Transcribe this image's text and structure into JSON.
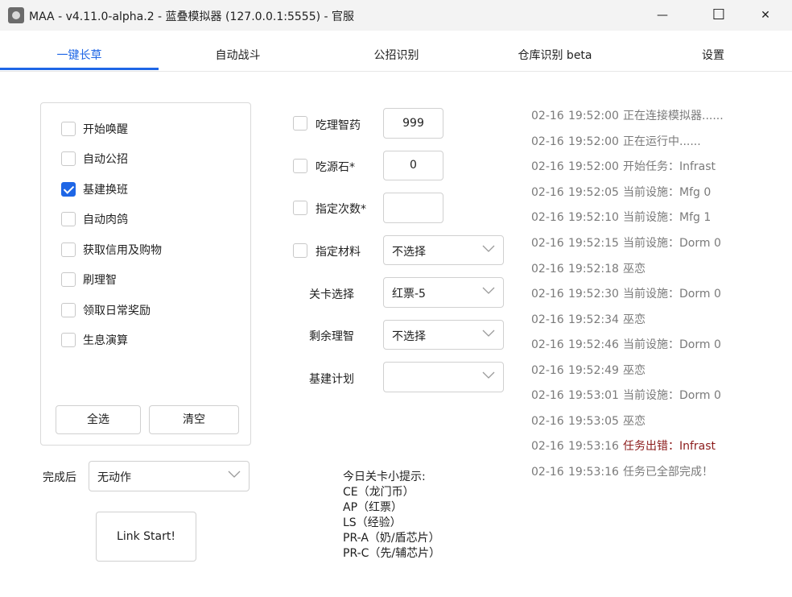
{
  "window": {
    "title": "MAA - v4.11.0-alpha.2 - 蓝叠模拟器 (127.0.0.1:5555) - 官服",
    "controls": {
      "minimize": "—",
      "maximize": "☐",
      "close": "✕"
    }
  },
  "tabs": [
    {
      "label": "一键长草"
    },
    {
      "label": "自动战斗"
    },
    {
      "label": "公招识别"
    },
    {
      "label": "仓库识别 beta"
    },
    {
      "label": "设置"
    }
  ],
  "tasks": {
    "items": [
      {
        "label": "开始唤醒",
        "checked": false
      },
      {
        "label": "自动公招",
        "checked": false
      },
      {
        "label": "基建换班",
        "checked": true
      },
      {
        "label": "自动肉鸽",
        "checked": false
      },
      {
        "label": "获取信用及购物",
        "checked": false
      },
      {
        "label": "刷理智",
        "checked": false
      },
      {
        "label": "领取日常奖励",
        "checked": false
      },
      {
        "label": "生息演算",
        "checked": false
      }
    ],
    "select_all_label": "全选",
    "clear_label": "清空"
  },
  "after_complete": {
    "label": "完成后",
    "value": "无动作"
  },
  "link_start_label": "Link Start!",
  "options": {
    "use_potion": {
      "label": "吃理智药",
      "value": "999",
      "checked": false
    },
    "use_stone": {
      "label": "吃源石*",
      "value": "0",
      "checked": false
    },
    "times": {
      "label": "指定次数*",
      "value": "",
      "checked": false
    },
    "material": {
      "label": "指定材料",
      "value": "不选择",
      "checked": false
    },
    "stage": {
      "label": "关卡选择",
      "value": "红票-5"
    },
    "remaining": {
      "label": "剩余理智",
      "value": "不选择"
    },
    "infrast_plan": {
      "label": "基建计划",
      "value": ""
    }
  },
  "hints": {
    "title": "今日关卡小提示:",
    "lines": [
      "CE（龙门币）",
      "AP（红票）",
      "LS（经验）",
      "PR-A（奶/盾芯片）",
      "PR-C（先/辅芯片）"
    ]
  },
  "logs": [
    {
      "date": "02-16",
      "time": "19:52:00",
      "msg": "正在连接模拟器......",
      "error": false
    },
    {
      "date": "02-16",
      "time": "19:52:00",
      "msg": "正在运行中......",
      "error": false
    },
    {
      "date": "02-16",
      "time": "19:52:00",
      "msg": "开始任务：Infrast",
      "error": false
    },
    {
      "date": "02-16",
      "time": "19:52:05",
      "msg": "当前设施：Mfg 0",
      "error": false
    },
    {
      "date": "02-16",
      "time": "19:52:10",
      "msg": "当前设施：Mfg 1",
      "error": false
    },
    {
      "date": "02-16",
      "time": "19:52:15",
      "msg": "当前设施：Dorm 0",
      "error": false
    },
    {
      "date": "02-16",
      "time": "19:52:18",
      "msg": "巫恋",
      "error": false
    },
    {
      "date": "02-16",
      "time": "19:52:30",
      "msg": "当前设施：Dorm 0",
      "error": false
    },
    {
      "date": "02-16",
      "time": "19:52:34",
      "msg": "巫恋",
      "error": false
    },
    {
      "date": "02-16",
      "time": "19:52:46",
      "msg": "当前设施：Dorm 0",
      "error": false
    },
    {
      "date": "02-16",
      "time": "19:52:49",
      "msg": "巫恋",
      "error": false
    },
    {
      "date": "02-16",
      "time": "19:53:01",
      "msg": "当前设施：Dorm 0",
      "error": false
    },
    {
      "date": "02-16",
      "time": "19:53:05",
      "msg": "巫恋",
      "error": false
    },
    {
      "date": "02-16",
      "time": "19:53:16",
      "msg": "任务出错：Infrast",
      "error": true
    },
    {
      "date": "02-16",
      "time": "19:53:16",
      "msg": "任务已全部完成！",
      "error": false
    }
  ],
  "colors": {
    "accent": "#1e66e6",
    "error": "#8b1a1a",
    "log_text": "#7a7a7a"
  }
}
